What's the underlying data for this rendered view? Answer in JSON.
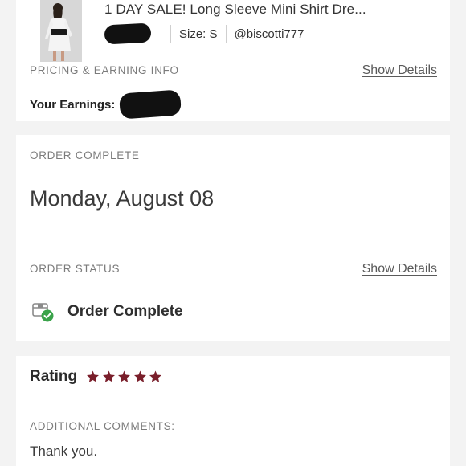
{
  "listing": {
    "title": "1 DAY SALE! Long Sleeve Mini Shirt Dre...",
    "size": "Size: S",
    "seller": "@biscotti777"
  },
  "pricing": {
    "label": "PRICING & EARNING INFO",
    "show_details": "Show Details",
    "earnings_label": "Your Earnings:"
  },
  "order_complete": {
    "label": "ORDER COMPLETE",
    "date": "Monday, August 08"
  },
  "order_status": {
    "label": "ORDER STATUS",
    "show_details": "Show Details",
    "status": "Order Complete",
    "status_icon": "box-check-icon"
  },
  "rating": {
    "label": "Rating",
    "stars": 5,
    "star_color": "#7a1f2b"
  },
  "comments": {
    "label": "ADDITIONAL COMMENTS:",
    "text": "Thank you."
  },
  "colors": {
    "background": "#f3f3f3",
    "check_green": "#3aa34a"
  }
}
